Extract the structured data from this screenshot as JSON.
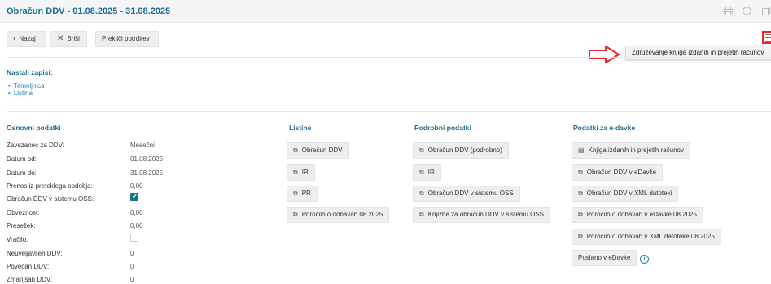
{
  "header": {
    "title": "Obračun DDV - 01.08.2025 - 31.08.2025",
    "icons": [
      "print-icon",
      "info-icon",
      "copy-icon"
    ]
  },
  "toolbar": {
    "back_label": "Nazaj",
    "delete_label": "Briši",
    "cancel_confirm_label": "Prekliči potrditev"
  },
  "menu": {
    "icon": "hamburger-icon",
    "tooltip": "Združevanje knjige izdanih in prejetih računov"
  },
  "records": {
    "title": "Nastali zapisi:",
    "items": [
      "Temeljnica",
      "Listina"
    ]
  },
  "basic": {
    "title": "Osnovni podatki",
    "rows": [
      {
        "label": "Zavezanec za DDV:",
        "value": "Mesečni"
      },
      {
        "label": "Datum od:",
        "value": "01.08.2025"
      },
      {
        "label": "Datum do:",
        "value": "31.08.2025"
      },
      {
        "label": "Prenos iz preteklega obdobja:",
        "value": "0,00"
      },
      {
        "label": "Obračun DDV v sistemu OSS:",
        "checked": true
      },
      {
        "label": "Obveznost:",
        "value": "0,00"
      },
      {
        "label": "Presežek:",
        "value": "0,00"
      },
      {
        "label": "Vračilo:",
        "checked": false
      },
      {
        "label": "Neuveljavljen DDV:",
        "value": "0"
      },
      {
        "label": "Povečan DDV:",
        "value": "0"
      },
      {
        "label": "Zmanjšan DDV:",
        "value": "0"
      }
    ]
  },
  "documents": {
    "title": "Listine",
    "buttons": [
      "Obračun DDV",
      "IR",
      "PR",
      "Poročilo o dobavah 08.2025"
    ]
  },
  "details": {
    "title": "Podrobni podatki",
    "buttons": [
      "Obračun DDV (podrobno)",
      "IR",
      "Obračun DDV v sistemu OSS",
      "Knjižbe za obračun DDV v sistemu OSS"
    ]
  },
  "edavki": {
    "title": "Podatki za e-davke",
    "buttons": [
      "Knjiga izdanih in prejetih računov",
      "Obračun DDV v eDavke",
      "Obračun DDV v XML datoteki",
      "Poročilo o dobavah v eDavke 08.2025",
      "Poročilo o dobavah v XML datoteke 08.2025",
      "Poslano v eDavke"
    ]
  },
  "colors": {
    "accent": "#1b6f95",
    "link": "#1b86b8",
    "highlight": "#e8262b"
  }
}
